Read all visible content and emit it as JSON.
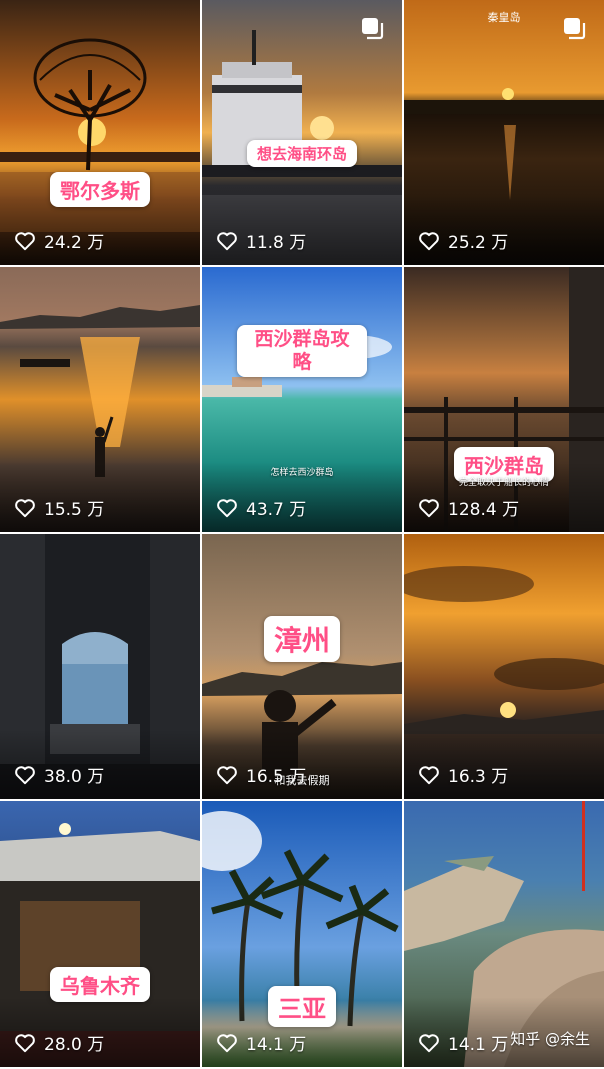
{
  "tiles": [
    {
      "likes": "24.2 万",
      "sticker": "鄂尔多斯"
    },
    {
      "likes": "11.8 万",
      "sticker": "想去海南环岛"
    },
    {
      "likes": "25.2 万",
      "top_label": "秦皇岛"
    },
    {
      "likes": "15.5 万"
    },
    {
      "likes": "43.7 万",
      "sticker": "西沙群岛攻略",
      "caption": "怎样去西沙群岛"
    },
    {
      "likes": "128.4 万",
      "sticker": "西沙群岛",
      "caption": "完全取决于船长的心情"
    },
    {
      "likes": "38.0 万"
    },
    {
      "likes": "16.5 万",
      "sticker": "漳州",
      "caption": "和我去假期"
    },
    {
      "likes": "16.3 万"
    },
    {
      "likes": "28.0 万",
      "sticker": "乌鲁木齐"
    },
    {
      "likes": "14.1 万",
      "sticker": "三亚"
    },
    {
      "likes": "14.1 万"
    }
  ],
  "watermark": "知乎 @余生",
  "icons": {
    "like": "heart-outline-icon",
    "multi": "multi-image-icon"
  }
}
